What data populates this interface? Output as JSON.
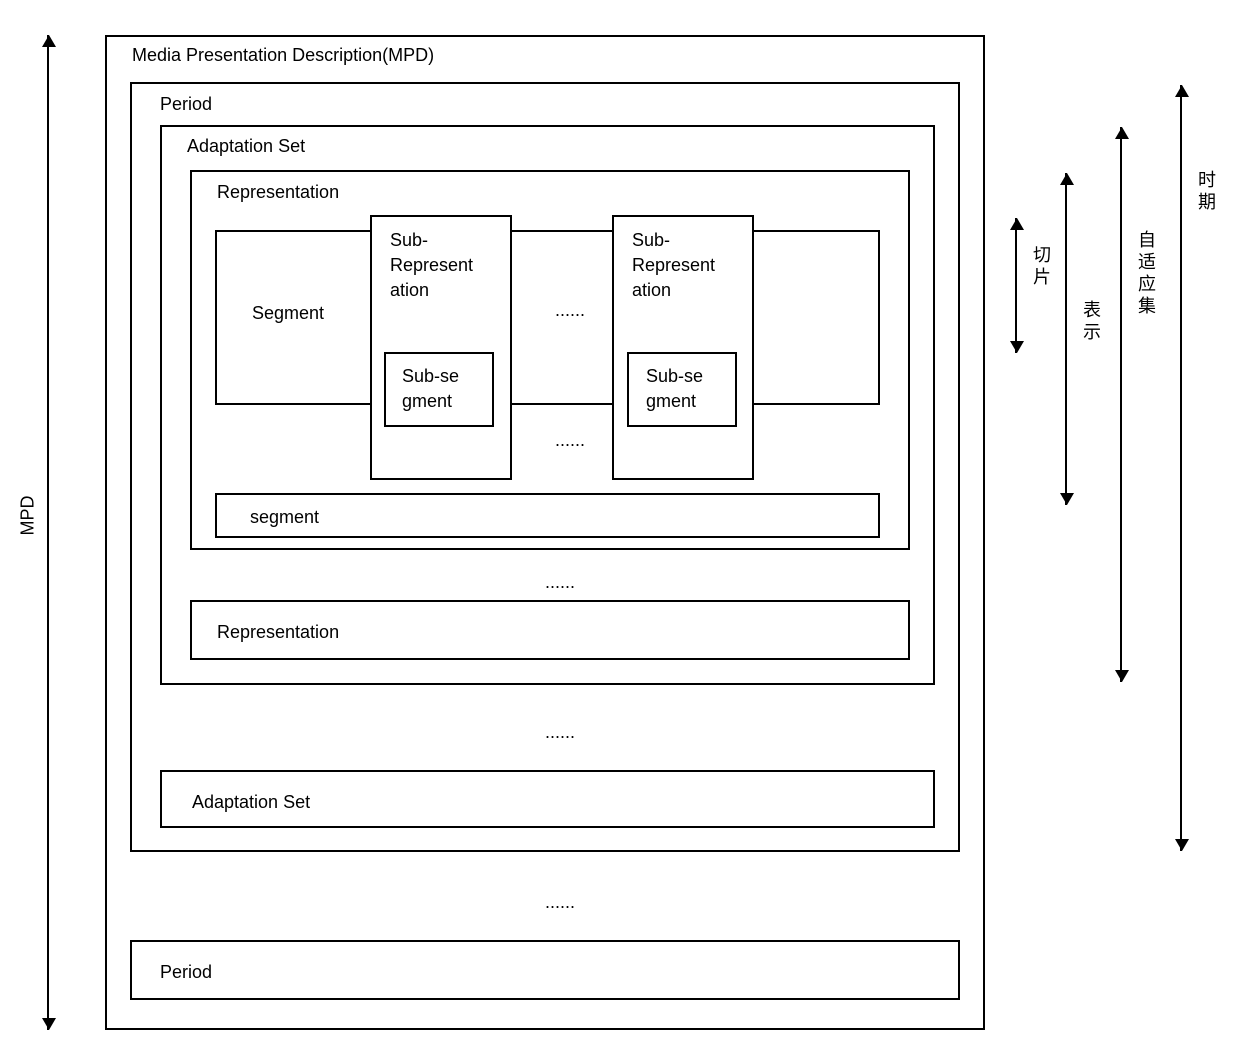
{
  "mpd": {
    "title": "Media Presentation Description(MPD)",
    "sideLabel": "MPD"
  },
  "period": {
    "title1": "Period",
    "title2": "Period"
  },
  "adaptationSet": {
    "title1": "Adaptation Set",
    "title2": "Adaptation Set"
  },
  "representation": {
    "title1": "Representation",
    "title2": "Representation"
  },
  "segment": {
    "title1": "Segment",
    "title2": "segment"
  },
  "subRepresentation": {
    "title": "Sub-Represent ation"
  },
  "subSegment": {
    "title": "Sub-se gment"
  },
  "ellipsis": {
    "short": "......",
    "mid": "......"
  },
  "cnLabels": {
    "slice": "切片",
    "represent": "表示",
    "period": "时期",
    "adaptSet": "自适应集"
  }
}
